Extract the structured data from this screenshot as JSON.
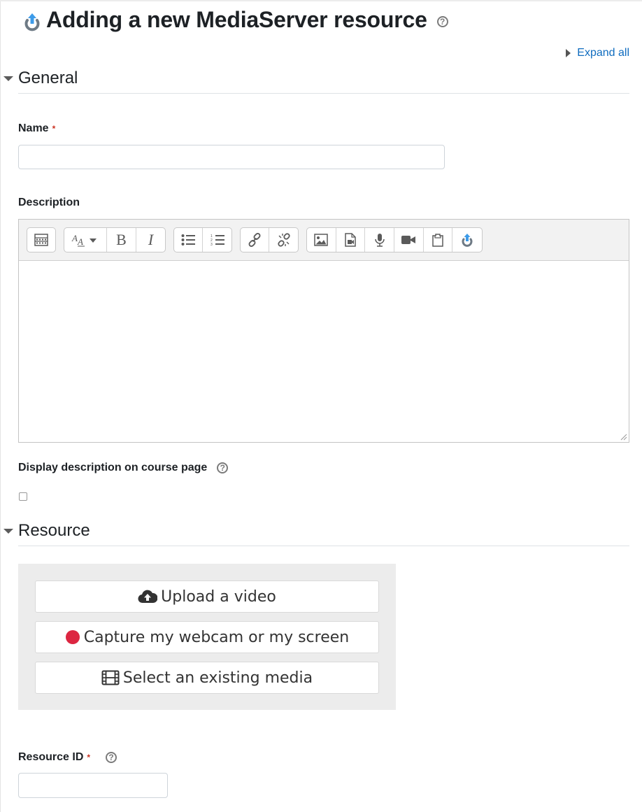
{
  "header": {
    "title": "Adding a new MediaServer resource",
    "help_glyph": "?"
  },
  "expand_all_label": "Expand all",
  "sections": {
    "general": {
      "title": "General"
    },
    "resource": {
      "title": "Resource"
    }
  },
  "fields": {
    "name": {
      "label": "Name",
      "required_mark": "*",
      "value": ""
    },
    "description": {
      "label": "Description",
      "value": ""
    },
    "display_description": {
      "label": "Display description on course page",
      "checked": false
    },
    "resource_id": {
      "label": "Resource ID",
      "required_mark": "*",
      "value": ""
    }
  },
  "editor": {
    "toolbar_groups": [
      [
        "toolbar-toggle-icon"
      ],
      [
        "font-style-icon",
        "bold-icon",
        "italic-icon"
      ],
      [
        "bullet-list-icon",
        "numbered-list-icon"
      ],
      [
        "link-icon",
        "unlink-icon"
      ],
      [
        "image-icon",
        "media-file-icon",
        "microphone-icon",
        "video-camera-icon",
        "paste-icon",
        "mediaserver-icon"
      ]
    ],
    "bold_glyph": "B",
    "italic_glyph": "I"
  },
  "media_buttons": {
    "upload": {
      "label": "Upload a video",
      "icon": "cloud-upload-icon"
    },
    "capture": {
      "label": "Capture my webcam or my screen",
      "icon": "record-dot-icon",
      "color": "#dc2641"
    },
    "select": {
      "label": "Select an existing media",
      "icon": "film-icon"
    }
  },
  "colors": {
    "link": "#0f6cbf",
    "required": "#ca3120",
    "logo_blue": "#3d9be9",
    "logo_grey": "#6e7a85"
  }
}
